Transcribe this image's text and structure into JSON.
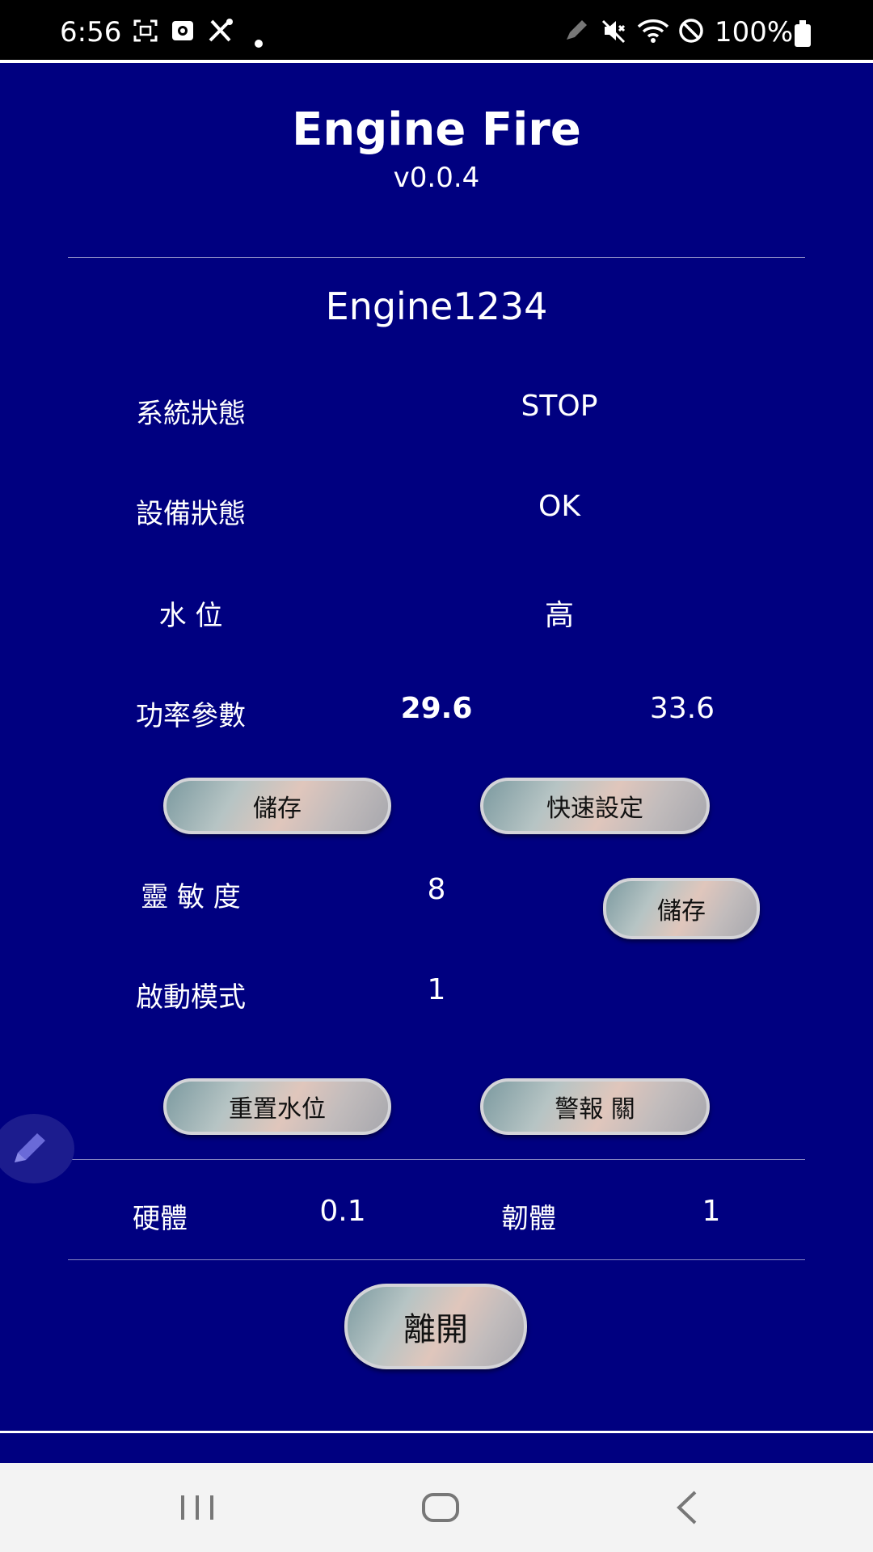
{
  "status_bar": {
    "time": "6:56",
    "battery": "100%",
    "left_icons": [
      "screenshot-icon",
      "camera-app-icon",
      "tools-icon",
      "dot-icon"
    ],
    "right_icons": [
      "pen-icon",
      "mute-icon",
      "wifi-icon",
      "do-not-disturb-icon",
      "battery-icon"
    ]
  },
  "header": {
    "title": "Engine Fire",
    "version": "v0.0.4"
  },
  "device_name": "Engine1234",
  "rows": {
    "system_status": {
      "label": "系統狀態",
      "value": "STOP"
    },
    "device_status": {
      "label": "設備狀態",
      "value": "OK"
    },
    "water_level": {
      "label": "水 位",
      "value": "高"
    },
    "power_params": {
      "label": "功率參數",
      "value1": "29.6",
      "value2": "33.6"
    },
    "sensitivity": {
      "label": "靈 敏 度",
      "value": "8"
    },
    "start_mode": {
      "label": "啟動模式",
      "value": "1"
    }
  },
  "buttons": {
    "save": "儲存",
    "quick_setup": "快速設定",
    "save_sensitivity": "儲存",
    "reset_water": "重置水位",
    "alarm_off": "警報 關",
    "exit": "離開"
  },
  "versions": {
    "hardware_label": "硬體",
    "hardware_value": "0.1",
    "firmware_label": "韌體",
    "firmware_value": "1"
  },
  "colors": {
    "background": "#000080",
    "text": "#ffffff",
    "button_border": "#d4d4d8"
  }
}
